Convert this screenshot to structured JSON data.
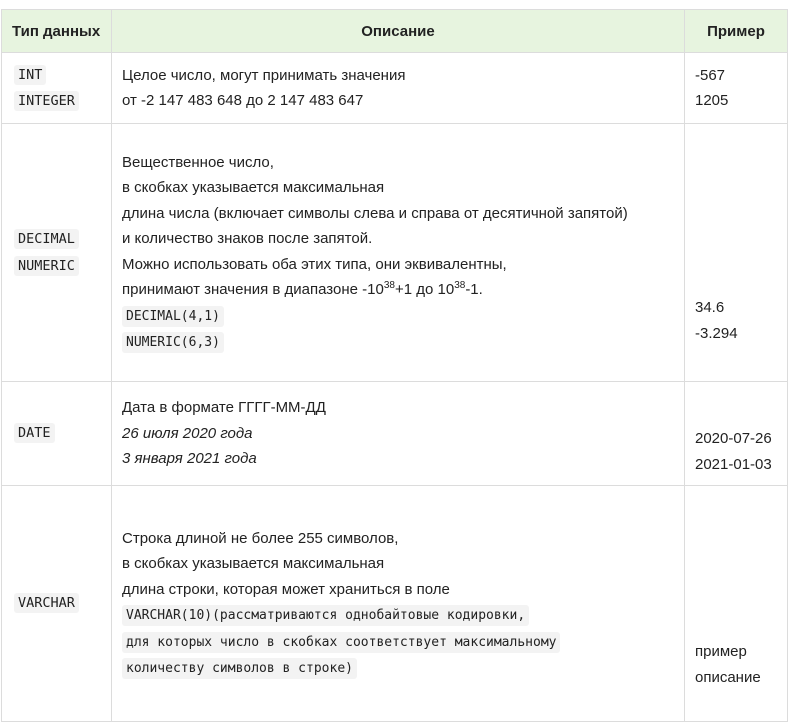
{
  "headers": {
    "type": "Тип данных",
    "desc": "Описание",
    "example": "Пример"
  },
  "rows": [
    {
      "types": [
        "INT",
        "INTEGER"
      ],
      "desc": [
        "Целое число, могут принимать значения",
        "от -2 147 483 648 до 2 147 483 647"
      ],
      "examples": [
        "-567",
        "1205"
      ]
    },
    {
      "types": [
        "DECIMAL",
        "NUMERIC"
      ],
      "desc": [
        "Вещественное число,",
        "в скобках указывается максимальная",
        "длина числа (включает символы слева и справа от десятичной запятой)",
        "и количество знаков после запятой.",
        "Можно использовать оба этих типа, они эквивалентны,"
      ],
      "range": {
        "prefix": "принимают значения в диапазоне -10",
        "exp1": "38",
        "middle": "+1 до 10",
        "exp2": "38",
        "suffix": "-1."
      },
      "code": [
        "DECIMAL(4,1)",
        "NUMERIC(6,3)"
      ],
      "examples": [
        "34.6",
        "-3.294"
      ]
    },
    {
      "types": [
        "DATE"
      ],
      "desc": [
        "Дата в формате ГГГГ-ММ-ДД"
      ],
      "desc_italic": [
        "26 июля 2020 года",
        "3 января 2021 года"
      ],
      "examples": [
        "2020-07-26",
        "2021-01-03"
      ]
    },
    {
      "types": [
        "VARCHAR"
      ],
      "desc": [
        "Строка длиной не более 255 символов,",
        "в скобках указывается максимальная",
        "длина строки, которая может храниться в поле"
      ],
      "code": [
        "VARCHAR(10)(рассматриваются однобайтовые кодировки,",
        "для которых число в скобках соответствует максимальному",
        "количеству символов в строке)"
      ],
      "examples": [
        "пример",
        "описание"
      ]
    }
  ]
}
